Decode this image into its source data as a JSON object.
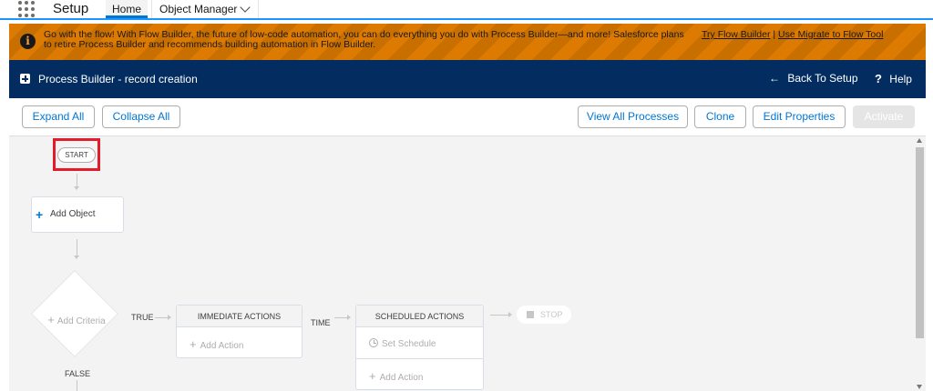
{
  "topnav": {
    "app_name": "Setup",
    "tabs": [
      {
        "label": "Home"
      },
      {
        "label": "Object Manager"
      }
    ]
  },
  "banner": {
    "message": "Go with the flow! With Flow Builder, the future of low-code automation, you can do everything you do with Process Builder—and more! Salesforce plans to retire Process Builder and recommends building automation in Flow Builder.",
    "link_try": "Try Flow Builder",
    "separator": "|",
    "link_migrate": "Use Migrate to Flow Tool"
  },
  "header": {
    "title": "Process Builder - record creation",
    "back_label": "Back To Setup",
    "help_label": "Help"
  },
  "toolbar": {
    "expand_all": "Expand All",
    "collapse_all": "Collapse All",
    "view_all": "View All Processes",
    "clone": "Clone",
    "edit_properties": "Edit Properties",
    "activate": "Activate"
  },
  "canvas": {
    "start_label": "START",
    "add_object": "Add Object",
    "add_criteria": "Add Criteria",
    "true_label": "TRUE",
    "false_label": "FALSE",
    "time_label": "TIME",
    "immediate_title": "IMMEDIATE ACTIONS",
    "immediate_add": "Add Action",
    "scheduled_title": "SCHEDULED ACTIONS",
    "scheduled_set": "Set Schedule",
    "scheduled_add": "Add Action",
    "stop_label": "STOP"
  },
  "colors": {
    "banner": "#dd7a01",
    "header": "#032d60",
    "accent": "#0176d3",
    "highlight": "#e31c2b"
  }
}
